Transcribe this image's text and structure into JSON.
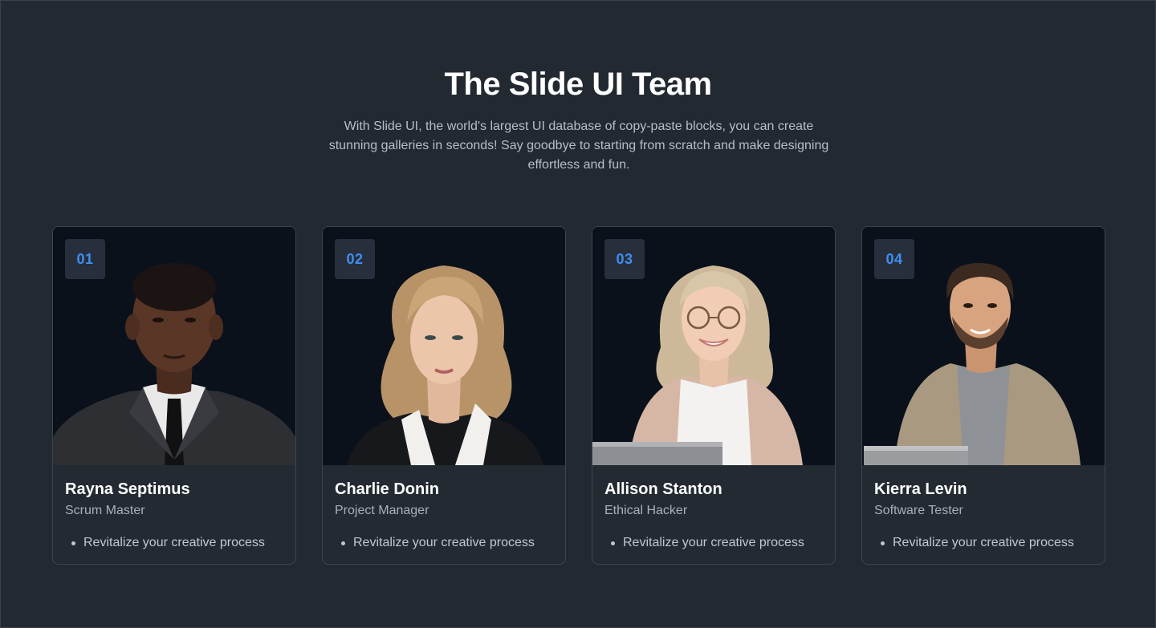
{
  "header": {
    "title": "The Slide UI Team",
    "subtitle": "With Slide UI, the world's largest UI database of copy-paste blocks, you can create stunning galleries in seconds! Say goodbye to starting from scratch and make designing effortless and fun."
  },
  "team": [
    {
      "number": "01",
      "name": "Rayna Septimus",
      "role": "Scrum Master",
      "bullet": "Revitalize your creative process"
    },
    {
      "number": "02",
      "name": "Charlie Donin",
      "role": "Project Manager",
      "bullet": "Revitalize your creative process"
    },
    {
      "number": "03",
      "name": "Allison Stanton",
      "role": "Ethical Hacker",
      "bullet": "Revitalize your creative process"
    },
    {
      "number": "04",
      "name": "Kierra Levin",
      "role": "Software Tester",
      "bullet": "Revitalize your creative process"
    }
  ],
  "colors": {
    "background": "#222931",
    "card_border": "#3d4550",
    "photo_background": "#0b111b",
    "badge_text": "#3f8ef0",
    "badge_background": "#262f3b"
  }
}
